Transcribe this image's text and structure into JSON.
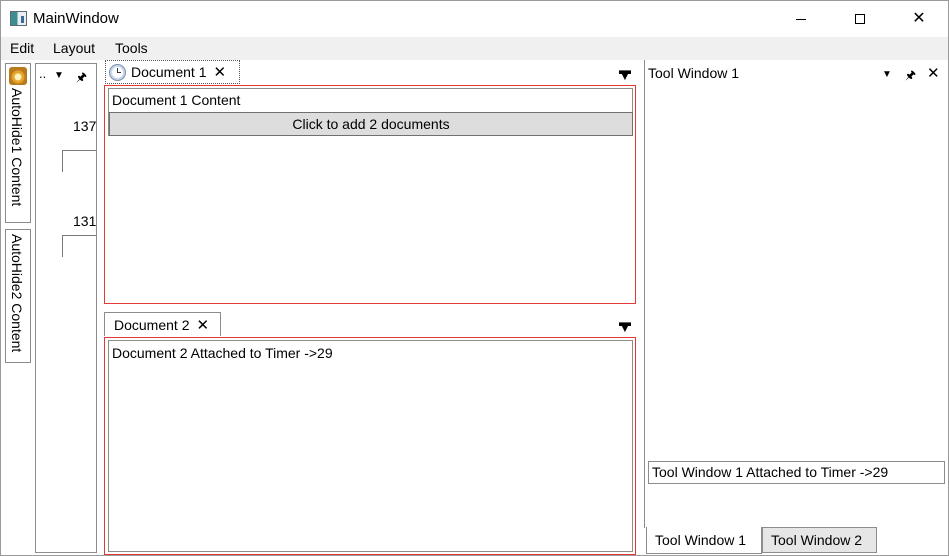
{
  "window": {
    "title": "MainWindow",
    "icon": "app-window-icon"
  },
  "menu": {
    "items": [
      "Edit",
      "Layout",
      "Tools"
    ]
  },
  "auto_hide": {
    "tabs": [
      {
        "label": "AutoHide1 Content",
        "icon": "autohide-content-icon"
      },
      {
        "label": "AutoHide2 Content"
      }
    ]
  },
  "side_panel": {
    "dots": "..",
    "values": [
      "137",
      "131"
    ]
  },
  "documents": {
    "doc1": {
      "tab_label": "Document 1",
      "content_label": "Document 1 Content",
      "button_label": "Click to add 2 documents"
    },
    "doc2": {
      "tab_label": "Document 2",
      "content_text": "Document 2 Attached to Timer ->29"
    }
  },
  "tool_window": {
    "title": "Tool Window 1",
    "status_text": "Tool Window 1 Attached to Timer ->29",
    "tabs": [
      "Tool Window 1",
      "Tool Window 2"
    ],
    "selected_tab": "Tool Window 1"
  },
  "colors": {
    "pane_border": "#e53935",
    "menubar_bg": "#f0f0f0",
    "button_bg": "#dddddd"
  }
}
